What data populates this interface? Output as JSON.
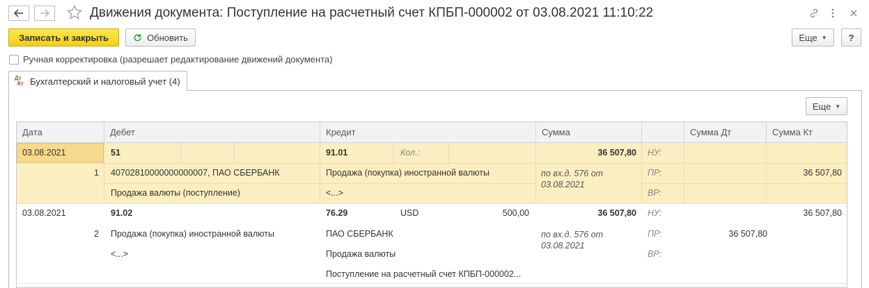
{
  "window": {
    "title": "Движения документа: Поступление на расчетный счет КПБП-000002 от 03.08.2021 11:10:22"
  },
  "toolbar": {
    "save_close": "Записать и закрыть",
    "refresh": "Обновить",
    "more": "Еще",
    "help": "?"
  },
  "manual_correction": {
    "label": "Ручная корректировка (разрешает редактирование движений документа)",
    "checked": false
  },
  "tabs": [
    {
      "icon_dt": "Дт",
      "icon_kt": "Кт",
      "label": "Бухгалтерский и налоговый учет (4)"
    }
  ],
  "table_toolbar": {
    "more": "Еще"
  },
  "table": {
    "columns": [
      "Дата",
      "Дебет",
      "Кредит",
      "Сумма",
      "",
      "Сумма Дт",
      "Сумма Кт"
    ],
    "rows": [
      {
        "date": "03.08.2021",
        "number": "1",
        "debit_account": "51",
        "debit_sub1": "40702810000000000007, ПАО СБЕРБАНК",
        "debit_sub2": "Продажа валюты (поступление)",
        "credit_account": "91.01",
        "credit_qty_label": "Кол.:",
        "credit_sub1": "Продажа (покупка) иностранной валюты",
        "credit_sub2": "<...>",
        "amount": "36 507,80",
        "content": "по вх.д. 576 от 03.08.2021",
        "nu_label": "НУ:",
        "pr_label": "ПР:",
        "vr_label": "ВР:",
        "sum_kt_pr": "36 507,80"
      },
      {
        "date": "03.08.2021",
        "number": "2",
        "debit_account": "91.02",
        "debit_sub1": "Продажа (покупка) иностранной валюты",
        "debit_sub2": "<...>",
        "credit_account": "76.29",
        "credit_currency": "USD",
        "credit_currency_amount": "500,00",
        "credit_sub1": "ПАО СБЕРБАНК",
        "credit_sub2": "Продажа валюты",
        "credit_sub3": "Поступление на расчетный счет КПБП-000002...",
        "amount": "36 507,80",
        "content": "по вх.д. 576 от 03.08.2021",
        "nu_label": "НУ:",
        "pr_label": "ПР:",
        "vr_label": "ВР:",
        "sum_kt_nu": "36 507,80",
        "sum_dt_pr": "36 507,80"
      }
    ]
  }
}
